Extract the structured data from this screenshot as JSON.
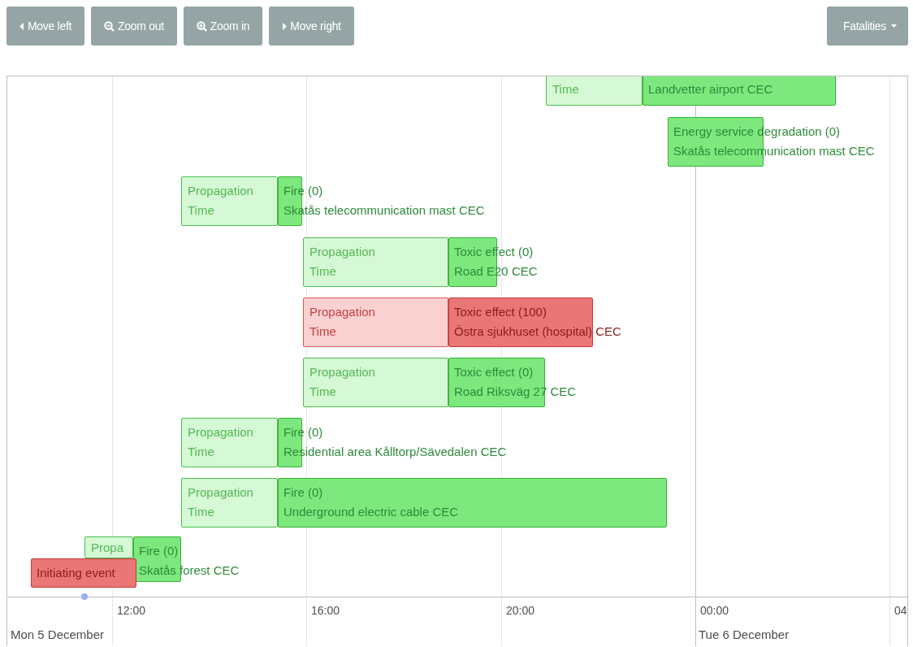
{
  "toolbar": {
    "buttons": [
      {
        "kind": "left",
        "label": "Move left"
      },
      {
        "kind": "zoom_out",
        "label": "Zoom out"
      },
      {
        "kind": "zoom_in",
        "label": "Zoom in"
      },
      {
        "kind": "right",
        "label": "Move right"
      }
    ],
    "dropdown": {
      "label": "Fatalities"
    }
  },
  "timeline": {
    "items": [
      {
        "alert": false,
        "propagation": "Time",
        "location": "Landvetter airport CEC"
      },
      {
        "alert": false,
        "title": "Energy service degradation (0)",
        "location": "Skatås telecommunication mast CEC"
      },
      {
        "alert": false,
        "propagation": "Propagation Time",
        "title": "Fire (0)",
        "location": "Skatås telecommunication mast CEC"
      },
      {
        "alert": false,
        "propagation": "Propagation Time",
        "title": "Toxic effect (0)",
        "location": "Road E20 CEC"
      },
      {
        "alert": true,
        "propagation": "Propagation Time",
        "title": "Toxic effect (100)",
        "location": "Östra sjukhuset (hospital) CEC"
      },
      {
        "alert": false,
        "propagation": "Propagation Time",
        "title": "Toxic effect (0)",
        "location": "Road Riksväg 27 CEC"
      },
      {
        "alert": false,
        "propagation": "Propagation Time",
        "title": "Fire (0)",
        "location": "Residential area Kålltorp/Sävedalen CEC"
      },
      {
        "alert": false,
        "propagation": "Propagation Time",
        "title": "Fire (0)",
        "location": "Underground electric cable CEC"
      },
      {
        "alert": false,
        "propagation": "Propa",
        "title": "Fire (0)",
        "location": "Skatås forest CEC"
      }
    ],
    "initiating_event": {
      "alert": true,
      "label": "Initiating event"
    },
    "axis": {
      "hours": [
        "12:00",
        "16:00",
        "20:00",
        "00:00",
        "04"
      ],
      "dates": [
        "Mon 5 December",
        "Tue 6 December"
      ]
    }
  }
}
